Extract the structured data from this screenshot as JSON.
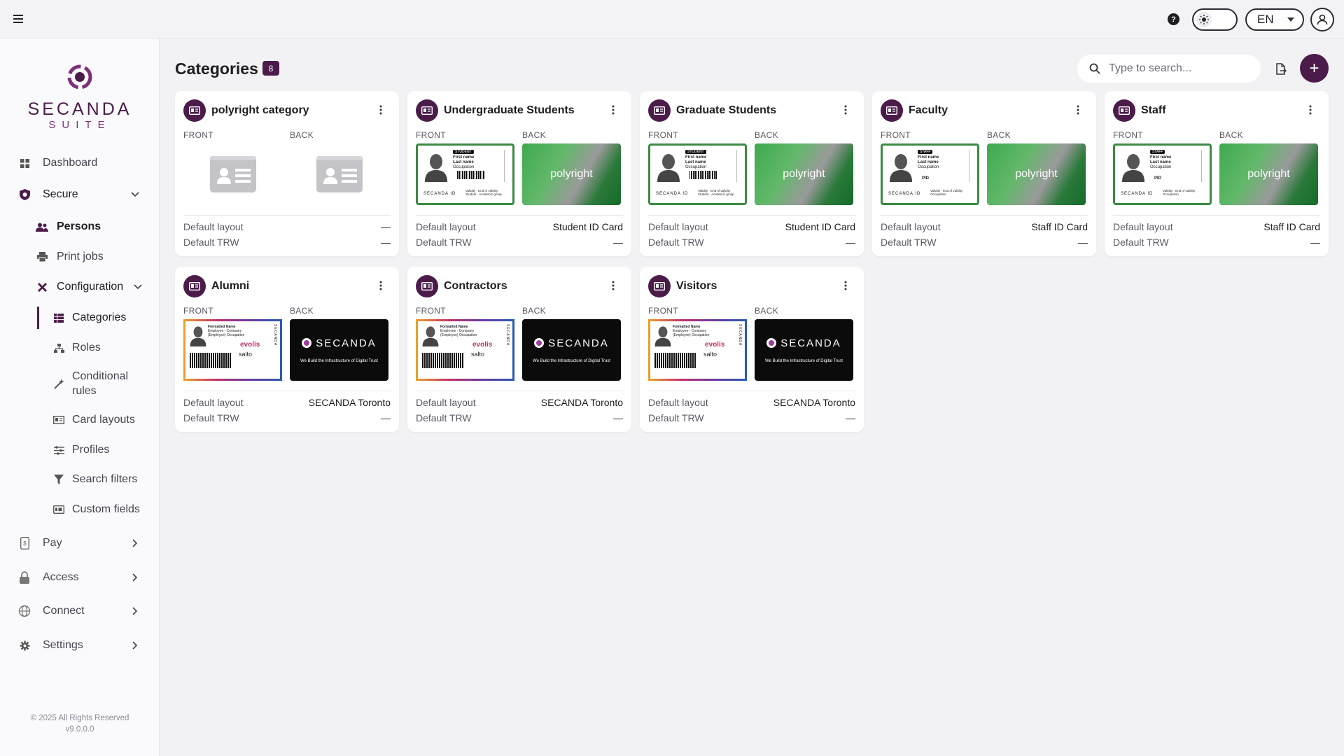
{
  "topbar": {
    "menu_icon": "hamburger-icon",
    "help_icon": "help-icon",
    "theme_icon": "sun-icon",
    "language": "EN",
    "user_icon": "user-icon"
  },
  "sidebar": {
    "logo_word": "SECANDA",
    "logo_sub": "SUITE",
    "items": [
      {
        "label": "Dashboard",
        "icon": "grid-icon"
      },
      {
        "label": "Secure",
        "icon": "shield-icon"
      },
      {
        "label": "Persons",
        "icon": "people-icon"
      },
      {
        "label": "Print jobs",
        "icon": "printer-icon"
      },
      {
        "label": "Configuration",
        "icon": "tools-icon"
      },
      {
        "label": "Categories",
        "icon": "table-icon"
      },
      {
        "label": "Roles",
        "icon": "hierarchy-icon"
      },
      {
        "label": "Conditional rules",
        "icon": "wand-icon"
      },
      {
        "label": "Card layouts",
        "icon": "id-card-icon"
      },
      {
        "label": "Profiles",
        "icon": "sliders-icon"
      },
      {
        "label": "Search filters",
        "icon": "filter-icon"
      },
      {
        "label": "Custom fields",
        "icon": "custom-field-icon"
      },
      {
        "label": "Pay",
        "icon": "pay-icon"
      },
      {
        "label": "Access",
        "icon": "lock-icon"
      },
      {
        "label": "Connect",
        "icon": "globe-icon"
      },
      {
        "label": "Settings",
        "icon": "gear-icon"
      }
    ],
    "footer_copyright": "© 2025 All Rights Reserved",
    "footer_version": "v9.0.0.0"
  },
  "main": {
    "title": "Categories",
    "count": "8",
    "search_placeholder": "Type to search...",
    "add_label": "+"
  },
  "labels": {
    "front": "FRONT",
    "back": "BACK",
    "default_layout": "Default layout",
    "default_trw": "Default TRW"
  },
  "cards": [
    {
      "name": "polyright category",
      "layout": "—",
      "trw": "—"
    },
    {
      "name": "Undergraduate Students",
      "layout": "Student ID Card",
      "trw": "—"
    },
    {
      "name": "Graduate Students",
      "layout": "Student ID Card",
      "trw": "—"
    },
    {
      "name": "Faculty",
      "layout": "Staff ID Card",
      "trw": "—"
    },
    {
      "name": "Staff",
      "layout": "Staff ID Card",
      "trw": "—"
    },
    {
      "name": "Alumni",
      "layout": "SECANDA Toronto",
      "trw": "—"
    },
    {
      "name": "Contractors",
      "layout": "SECANDA Toronto",
      "trw": "—"
    },
    {
      "name": "Visitors",
      "layout": "SECANDA Toronto",
      "trw": "—"
    }
  ],
  "card_art": {
    "polyright": "polyright",
    "secanda": "SECANDA",
    "secanda_tagline": "We Build the Infrastructure of Digital Trust",
    "student_tag": "STUDENT",
    "staff_tag": "STAFF",
    "first_name": "First name",
    "last_name": "Last name",
    "occupation": "Occupation",
    "secanda_id": "SECANDA ID",
    "student_validity": "Validity · End of validity Student · Academic group",
    "staff_validity": "Validity · End of validity Occupation",
    "pid": "PID",
    "formatted_name": "Formatted Name",
    "employee_company": "Employee - Company (Employee) Occupation",
    "evolis": "evolis",
    "salto": "salto"
  }
}
